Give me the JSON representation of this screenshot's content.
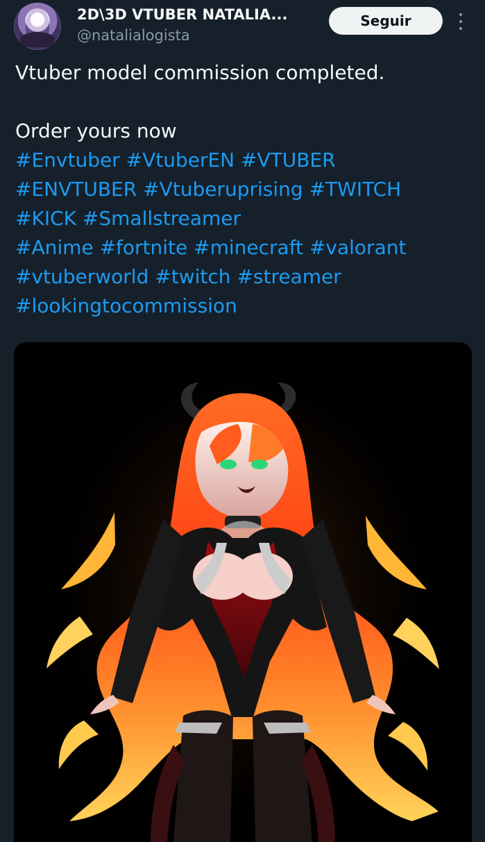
{
  "tweet": {
    "author": {
      "display_name": "2D\\3D VTUBER NATALIA...",
      "handle": "@natalialogista",
      "avatar_icon": "avatar-image"
    },
    "follow_label": "Seguir",
    "more_icon": "more-vertical-icon",
    "text_lines": [
      "Vtuber model commission completed.",
      "",
      "Order yours now"
    ],
    "hashtag_lines": [
      [
        "#Envtuber",
        "#VtuberEN",
        "#VTUBER"
      ],
      [
        "#ENVTUBER",
        "#Vtuberuprising",
        "#TWITCH"
      ],
      [
        "#KICK",
        "#Smallstreamer"
      ],
      [
        "#Anime",
        "#fortnite",
        "#minecraft",
        "#valorant"
      ],
      [
        "#vtuberworld",
        "#twitch",
        "#streamer"
      ],
      [
        "#lookingtocommission"
      ]
    ],
    "colors": {
      "background": "#15202b",
      "text": "#f7f9f9",
      "secondary_text": "#8b98a5",
      "hashtag": "#1d9bf0",
      "follow_button": "#eff3f4"
    }
  },
  "media": {
    "description_icon": "vtuber-character-image"
  }
}
